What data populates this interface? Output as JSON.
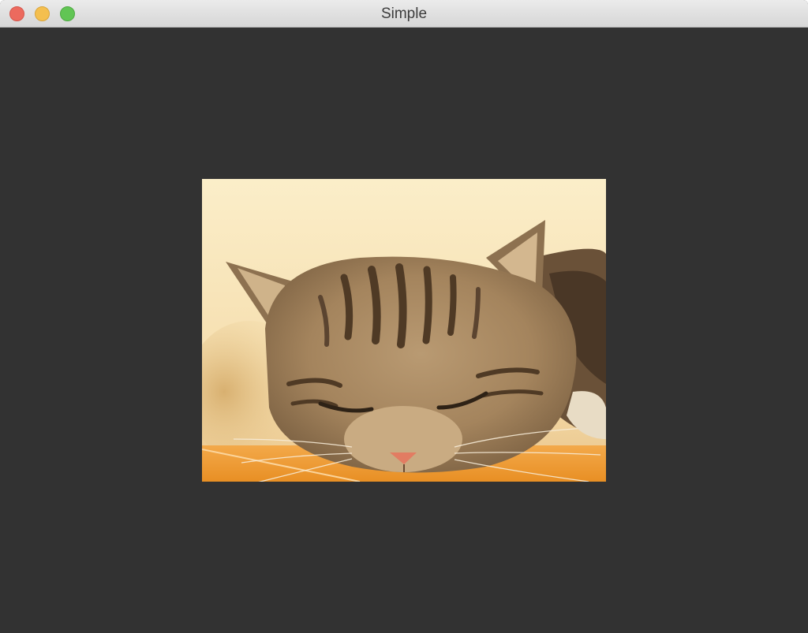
{
  "window": {
    "title": "Simple"
  },
  "colors": {
    "content_background": "#323232",
    "titlebar_text": "#3c3c3c",
    "close": "#ec6a5e",
    "minimize": "#f4bf4f",
    "zoom": "#61c554"
  }
}
